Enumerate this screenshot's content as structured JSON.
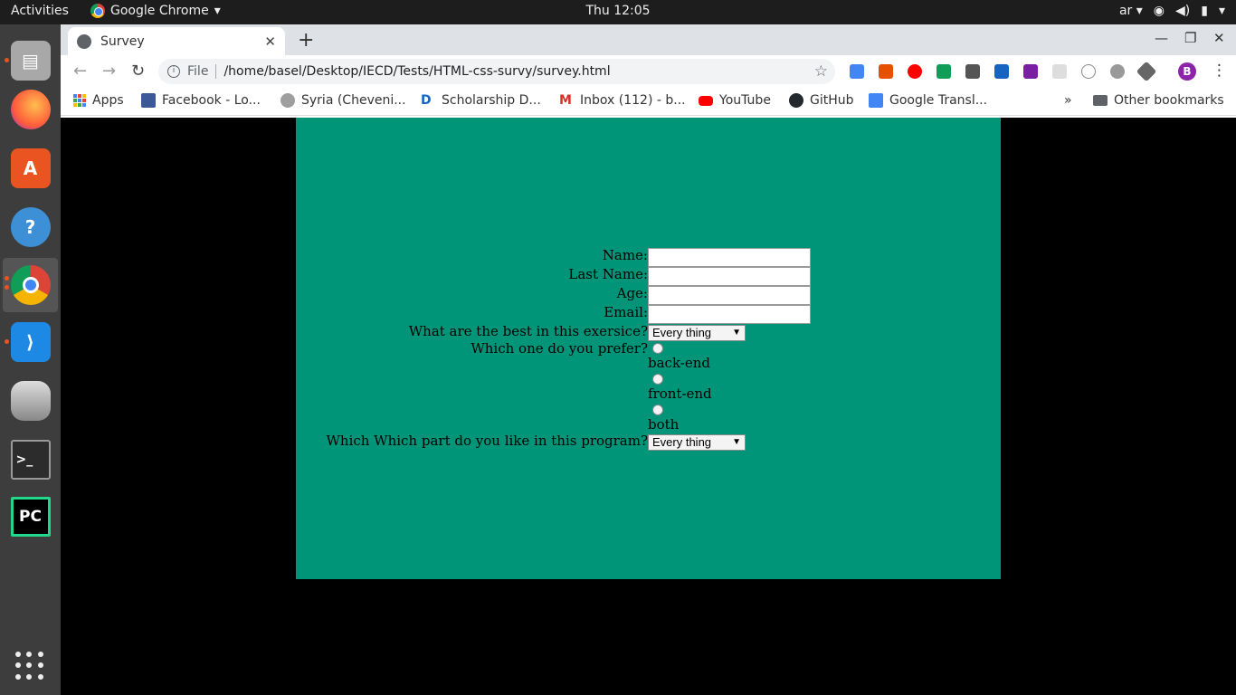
{
  "topbar": {
    "activities": "Activities",
    "app_name": "Google Chrome",
    "clock": "Thu 12:05",
    "lang": "ar"
  },
  "dock": {
    "items": [
      "files",
      "firefox",
      "software-center",
      "help",
      "chrome",
      "vscode",
      "database",
      "terminal",
      "pycharm"
    ]
  },
  "browser": {
    "tab_title": "Survey",
    "omnibox": {
      "scheme_label": "File",
      "url": "/home/basel/Desktop/IECD/Tests/HTML-css-survy/survey.html"
    },
    "profile_initial": "B",
    "bookmarks": [
      {
        "label": "Apps",
        "color": "#4285f4"
      },
      {
        "label": "Facebook - Lo...",
        "color": "#3b5998"
      },
      {
        "label": "Syria (Cheveni...",
        "color": "#9e9e9e"
      },
      {
        "label": "Scholarship D...",
        "color": "#1565c0"
      },
      {
        "label": "Inbox (112) - b...",
        "color": "#d93025"
      },
      {
        "label": "YouTube",
        "color": "#ff0000"
      },
      {
        "label": "GitHub",
        "color": "#24292e"
      },
      {
        "label": "Google Transl...",
        "color": "#4285f4"
      }
    ],
    "more_bookmarks": "»",
    "other_bookmarks": "Other bookmarks"
  },
  "survey": {
    "background": "#009579",
    "name_label": "Name:",
    "last_name_label": "Last Name:",
    "age_label": "Age:",
    "email_label": "Email:",
    "best_label": "What are the best in this exersice?",
    "best_selected": "Every thing",
    "prefer_label": "Which one do you prefer?",
    "options": [
      "back-end",
      "front-end",
      "both"
    ],
    "part_label": "Which Which part do you like in this program?",
    "part_selected": "Every thing"
  }
}
